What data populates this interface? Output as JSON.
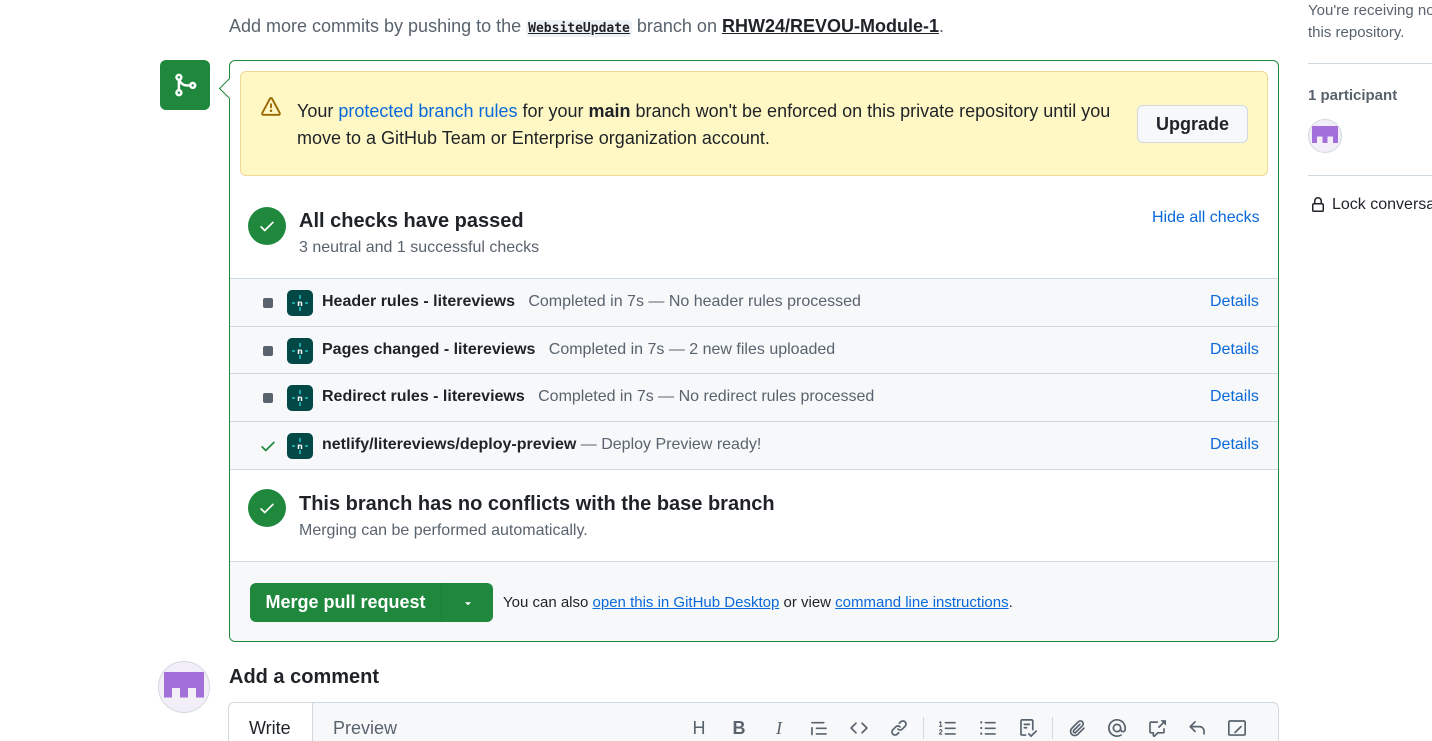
{
  "top_line": {
    "prefix": "Add more commits by pushing to the ",
    "branch": "WebsiteUpdate",
    "middle": " branch on ",
    "repo": "RHW24/REVOU-Module-1",
    "suffix": "."
  },
  "warning": {
    "text_1": "Your ",
    "link": "protected branch rules",
    "text_2": " for your ",
    "branch": "main",
    "text_3": " branch won't be enforced on this private repository until you move to a GitHub Team or Enterprise organization account.",
    "upgrade_label": "Upgrade"
  },
  "checks": {
    "title": "All checks have passed",
    "subtitle": "3 neutral and 1 successful checks",
    "hide_label": "Hide all checks",
    "items": [
      {
        "name": "Header rules - litereviews",
        "desc": "Completed in 7s — No header rules processed",
        "status": "neutral",
        "details": "Details"
      },
      {
        "name": "Pages changed - litereviews",
        "desc": "Completed in 7s — 2 new files uploaded",
        "status": "neutral",
        "details": "Details"
      },
      {
        "name": "Redirect rules - litereviews",
        "desc": "Completed in 7s — No redirect rules processed",
        "status": "neutral",
        "details": "Details"
      },
      {
        "name": "netlify/litereviews/deploy-preview",
        "desc": "— Deploy Preview ready!",
        "status": "success",
        "details": "Details"
      }
    ]
  },
  "conflicts": {
    "title": "This branch has no conflicts with the base branch",
    "subtitle": "Merging can be performed automatically."
  },
  "merge": {
    "button_label": "Merge pull request",
    "text_1": "You can also ",
    "link_desktop": "open this in GitHub Desktop",
    "text_2": " or view ",
    "link_cli": "command line instructions",
    "text_3": "."
  },
  "comment": {
    "title": "Add a comment",
    "tab_write": "Write",
    "tab_preview": "Preview"
  },
  "sidebar": {
    "notify_line_1": "You're receiving no",
    "notify_line_2": "this repository.",
    "participants": "1 participant",
    "lock_label": "Lock conversat"
  },
  "colors": {
    "success": "#1f883d",
    "link": "#0969da",
    "warning_bg": "#fff8c5",
    "netlify": "#014847",
    "muted": "#59636e"
  }
}
